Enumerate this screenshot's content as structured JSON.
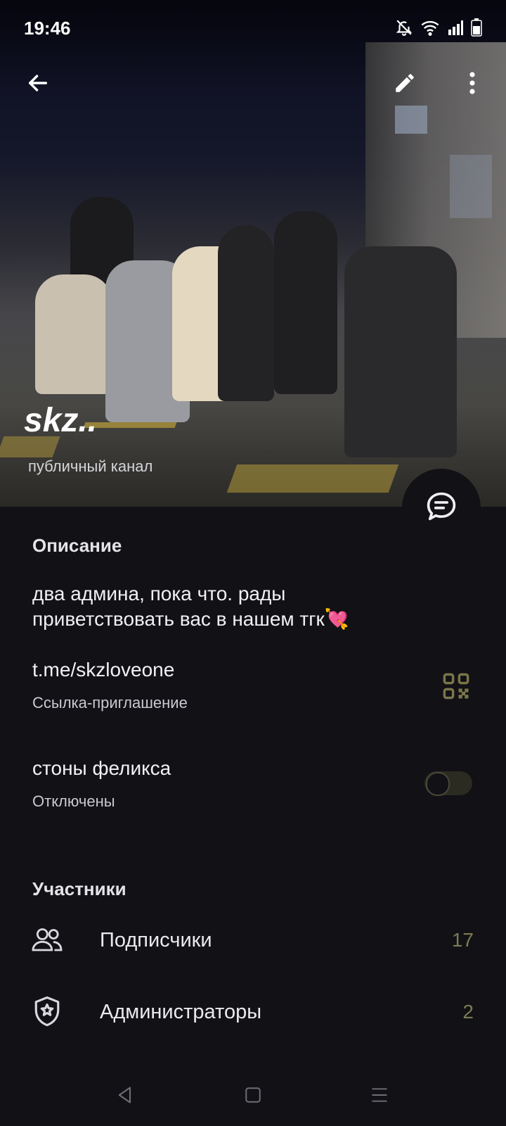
{
  "status_bar": {
    "time": "19:46",
    "icons": [
      "bell-off-icon",
      "wifi-icon",
      "signal-icon",
      "battery-icon"
    ]
  },
  "toolbar": {
    "back_icon": "arrow-left-icon",
    "edit_icon": "pencil-icon",
    "more_icon": "more-vertical-icon"
  },
  "channel": {
    "title": "skz..",
    "subtitle": "публичный канал"
  },
  "description": {
    "section_title": "Описание",
    "text": "два админа, пока что. рады приветствовать вас в нашем тгк💘"
  },
  "invite_link": {
    "url": "t.me/skzloveone",
    "label": "Ссылка-приглашение",
    "icon": "qr-code-icon"
  },
  "notifications": {
    "title": "стоны феликса",
    "state": "Отключены",
    "enabled": false
  },
  "participants": {
    "section_title": "Участники",
    "rows": [
      {
        "label": "Подписчики",
        "count": "17",
        "icon": "people-icon"
      },
      {
        "label": "Администраторы",
        "count": "2",
        "icon": "shield-star-icon"
      }
    ]
  },
  "colors": {
    "background": "#111116",
    "accent": "#7d7b52",
    "qr_icon": "#7a7648"
  },
  "navbar": {
    "icons": [
      "back-triangle-icon",
      "home-square-icon",
      "menu-lines-icon"
    ]
  }
}
